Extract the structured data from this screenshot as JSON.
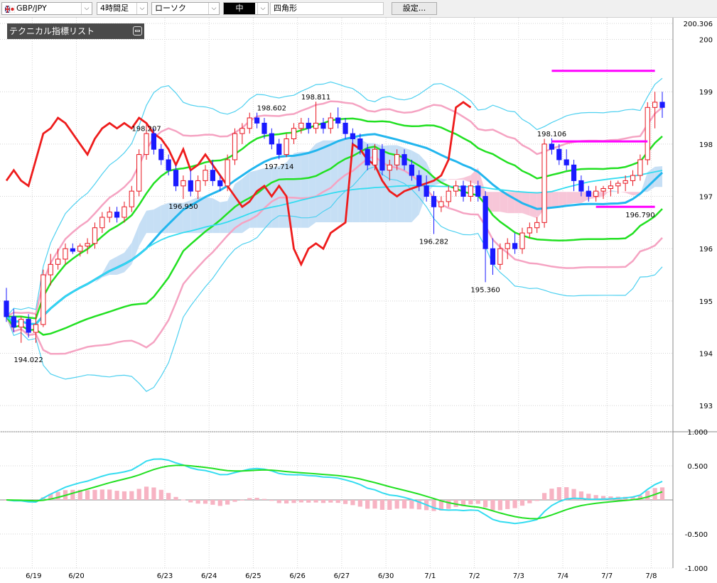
{
  "toolbar": {
    "symbol": "GBP/JPY",
    "timeframe": "4時間足",
    "chart_type": "ローソク",
    "line_width": "中",
    "drawing_shape": "四角形",
    "settings_button": "設定...",
    "icons": {
      "flags": "uk-jp-flag-icon",
      "dropdown": "chevron-down-icon"
    }
  },
  "indicator_panel": {
    "title": "テクニカル指標リスト",
    "icon": "toggle-panel-icon"
  },
  "colors": {
    "background": "#ffffff",
    "grid": "#d4d4d4",
    "candle_up": "#e8141e",
    "candle_down": "#1a1aff",
    "bb_outer": "#4dd0f0",
    "bb_2sigma": "#f5a3c2",
    "bb_1sigma": "#22e022",
    "center_sma": "#22b6ee",
    "long_ma": "#33dcf0",
    "chikou": "#ee1c1c",
    "cloud_bull": "#c6dff5",
    "cloud_bear": "#f7c6d8",
    "hline": "#ff00ff",
    "macd_line": "#33dcf0",
    "macd_signal": "#22e022",
    "macd_hist": "#f7b3c3"
  },
  "chart_data": [
    {
      "type": "candlestick",
      "title": "",
      "x_labels": [
        "6/19",
        "6/20",
        "6/23",
        "6/24",
        "6/25",
        "6/26",
        "6/27",
        "6/30",
        "7/1",
        "7/2",
        "7/3",
        "7/4",
        "7/7",
        "7/8"
      ],
      "y_ticks": [
        "200.306",
        "200",
        "199",
        "198",
        "197",
        "196",
        "195",
        "194",
        "193"
      ],
      "ylim": [
        192.5,
        200.306
      ],
      "grid": true,
      "annotations": [
        "194.022",
        "198.207",
        "196.950",
        "198.602",
        "197.714",
        "198.811",
        "196.282",
        "195.360",
        "198.106",
        "196.790"
      ],
      "ohlc": [
        [
          195.0,
          195.25,
          194.6,
          194.7
        ],
        [
          194.7,
          194.85,
          194.4,
          194.5
        ],
        [
          194.5,
          194.7,
          194.2,
          194.65
        ],
        [
          194.65,
          194.75,
          194.3,
          194.4
        ],
        [
          194.4,
          194.75,
          194.2,
          194.55
        ],
        [
          194.55,
          195.6,
          194.5,
          195.5
        ],
        [
          195.5,
          195.9,
          195.3,
          195.7
        ],
        [
          195.7,
          196.0,
          195.6,
          195.8
        ],
        [
          195.8,
          196.1,
          195.7,
          196.0
        ],
        [
          196.0,
          196.1,
          195.9,
          195.95
        ],
        [
          195.95,
          196.1,
          195.85,
          196.05
        ],
        [
          196.05,
          196.2,
          195.9,
          196.1
        ],
        [
          196.1,
          196.5,
          196.0,
          196.4
        ],
        [
          196.4,
          196.7,
          196.3,
          196.6
        ],
        [
          196.6,
          196.8,
          196.5,
          196.7
        ],
        [
          196.7,
          196.8,
          196.5,
          196.6
        ],
        [
          196.6,
          196.9,
          196.5,
          196.8
        ],
        [
          196.8,
          197.2,
          196.7,
          197.1
        ],
        [
          197.1,
          197.9,
          197.0,
          197.8
        ],
        [
          197.8,
          198.4,
          197.7,
          198.2
        ],
        [
          198.2,
          198.3,
          197.8,
          197.9
        ],
        [
          197.9,
          198.0,
          197.6,
          197.7
        ],
        [
          197.7,
          197.8,
          197.4,
          197.5
        ],
        [
          197.5,
          197.6,
          197.1,
          197.2
        ],
        [
          197.2,
          197.4,
          196.95,
          197.3
        ],
        [
          197.3,
          197.5,
          197.0,
          197.1
        ],
        [
          197.1,
          197.4,
          196.95,
          197.3
        ],
        [
          197.3,
          197.6,
          197.2,
          197.5
        ],
        [
          197.5,
          197.7,
          197.2,
          197.3
        ],
        [
          197.3,
          197.4,
          197.1,
          197.2
        ],
        [
          197.2,
          197.8,
          197.1,
          197.7
        ],
        [
          197.7,
          198.3,
          197.6,
          198.2
        ],
        [
          198.2,
          198.4,
          198.0,
          198.3
        ],
        [
          198.3,
          198.6,
          198.2,
          198.5
        ],
        [
          198.5,
          198.6,
          198.3,
          198.4
        ],
        [
          198.4,
          198.5,
          198.1,
          198.2
        ],
        [
          198.2,
          198.3,
          197.9,
          198.0
        ],
        [
          198.0,
          198.1,
          197.71,
          197.8
        ],
        [
          197.8,
          198.2,
          197.75,
          198.1
        ],
        [
          198.1,
          198.4,
          198.0,
          198.3
        ],
        [
          198.3,
          198.5,
          198.2,
          198.4
        ],
        [
          198.4,
          198.5,
          198.2,
          198.3
        ],
        [
          198.3,
          198.81,
          198.2,
          198.4
        ],
        [
          198.4,
          198.5,
          198.2,
          198.3
        ],
        [
          198.3,
          198.6,
          198.2,
          198.5
        ],
        [
          198.5,
          198.7,
          198.3,
          198.4
        ],
        [
          198.4,
          198.5,
          198.1,
          198.2
        ],
        [
          198.2,
          198.3,
          198.0,
          198.1
        ],
        [
          198.1,
          198.2,
          197.8,
          197.9
        ],
        [
          197.9,
          198.0,
          197.5,
          197.6
        ],
        [
          197.6,
          198.0,
          197.5,
          197.9
        ],
        [
          197.9,
          198.0,
          197.4,
          197.5
        ],
        [
          197.5,
          197.7,
          197.3,
          197.6
        ],
        [
          197.6,
          197.9,
          197.5,
          197.8
        ],
        [
          197.8,
          197.9,
          197.5,
          197.6
        ],
        [
          197.6,
          197.7,
          197.3,
          197.4
        ],
        [
          197.4,
          197.5,
          197.1,
          197.2
        ],
        [
          197.2,
          197.4,
          196.9,
          197.0
        ],
        [
          197.0,
          197.1,
          196.28,
          196.8
        ],
        [
          196.8,
          197.0,
          196.7,
          196.9
        ],
        [
          196.9,
          197.2,
          196.8,
          197.1
        ],
        [
          197.1,
          197.3,
          197.0,
          197.2
        ],
        [
          197.2,
          197.3,
          196.9,
          197.0
        ],
        [
          197.0,
          197.3,
          196.9,
          197.2
        ],
        [
          197.2,
          197.3,
          196.9,
          197.0
        ],
        [
          197.0,
          197.1,
          195.36,
          196.0
        ],
        [
          196.0,
          196.2,
          195.5,
          195.7
        ],
        [
          195.7,
          196.1,
          195.6,
          196.0
        ],
        [
          196.0,
          196.2,
          195.8,
          196.1
        ],
        [
          196.1,
          196.3,
          195.9,
          196.0
        ],
        [
          196.0,
          196.4,
          195.9,
          196.3
        ],
        [
          196.3,
          196.5,
          196.2,
          196.4
        ],
        [
          196.4,
          196.6,
          196.3,
          196.5
        ],
        [
          196.5,
          198.1,
          196.4,
          198.0
        ],
        [
          198.0,
          198.11,
          197.8,
          197.9
        ],
        [
          197.9,
          198.0,
          197.6,
          197.7
        ],
        [
          197.7,
          197.9,
          197.5,
          197.6
        ],
        [
          197.6,
          197.7,
          197.1,
          197.3
        ],
        [
          197.3,
          197.4,
          197.0,
          197.1
        ],
        [
          197.1,
          197.2,
          196.9,
          197.0
        ],
        [
          197.0,
          197.2,
          196.9,
          197.1
        ],
        [
          197.1,
          197.2,
          196.95,
          197.15
        ],
        [
          197.15,
          197.3,
          197.0,
          197.2
        ],
        [
          197.2,
          197.3,
          197.05,
          197.25
        ],
        [
          197.25,
          197.4,
          197.1,
          197.3
        ],
        [
          197.3,
          197.5,
          197.2,
          197.4
        ],
        [
          197.4,
          197.8,
          197.3,
          197.7
        ],
        [
          197.7,
          198.8,
          197.6,
          198.7
        ],
        [
          198.7,
          199.0,
          198.3,
          198.8
        ],
        [
          198.8,
          199.0,
          198.5,
          198.7
        ]
      ]
    },
    {
      "type": "line",
      "title": "",
      "y_ticks": [
        "1.000",
        "0.500",
        "-0.500",
        "-1.000"
      ],
      "ylim": [
        -1.0,
        1.0
      ],
      "grid": true
    }
  ]
}
